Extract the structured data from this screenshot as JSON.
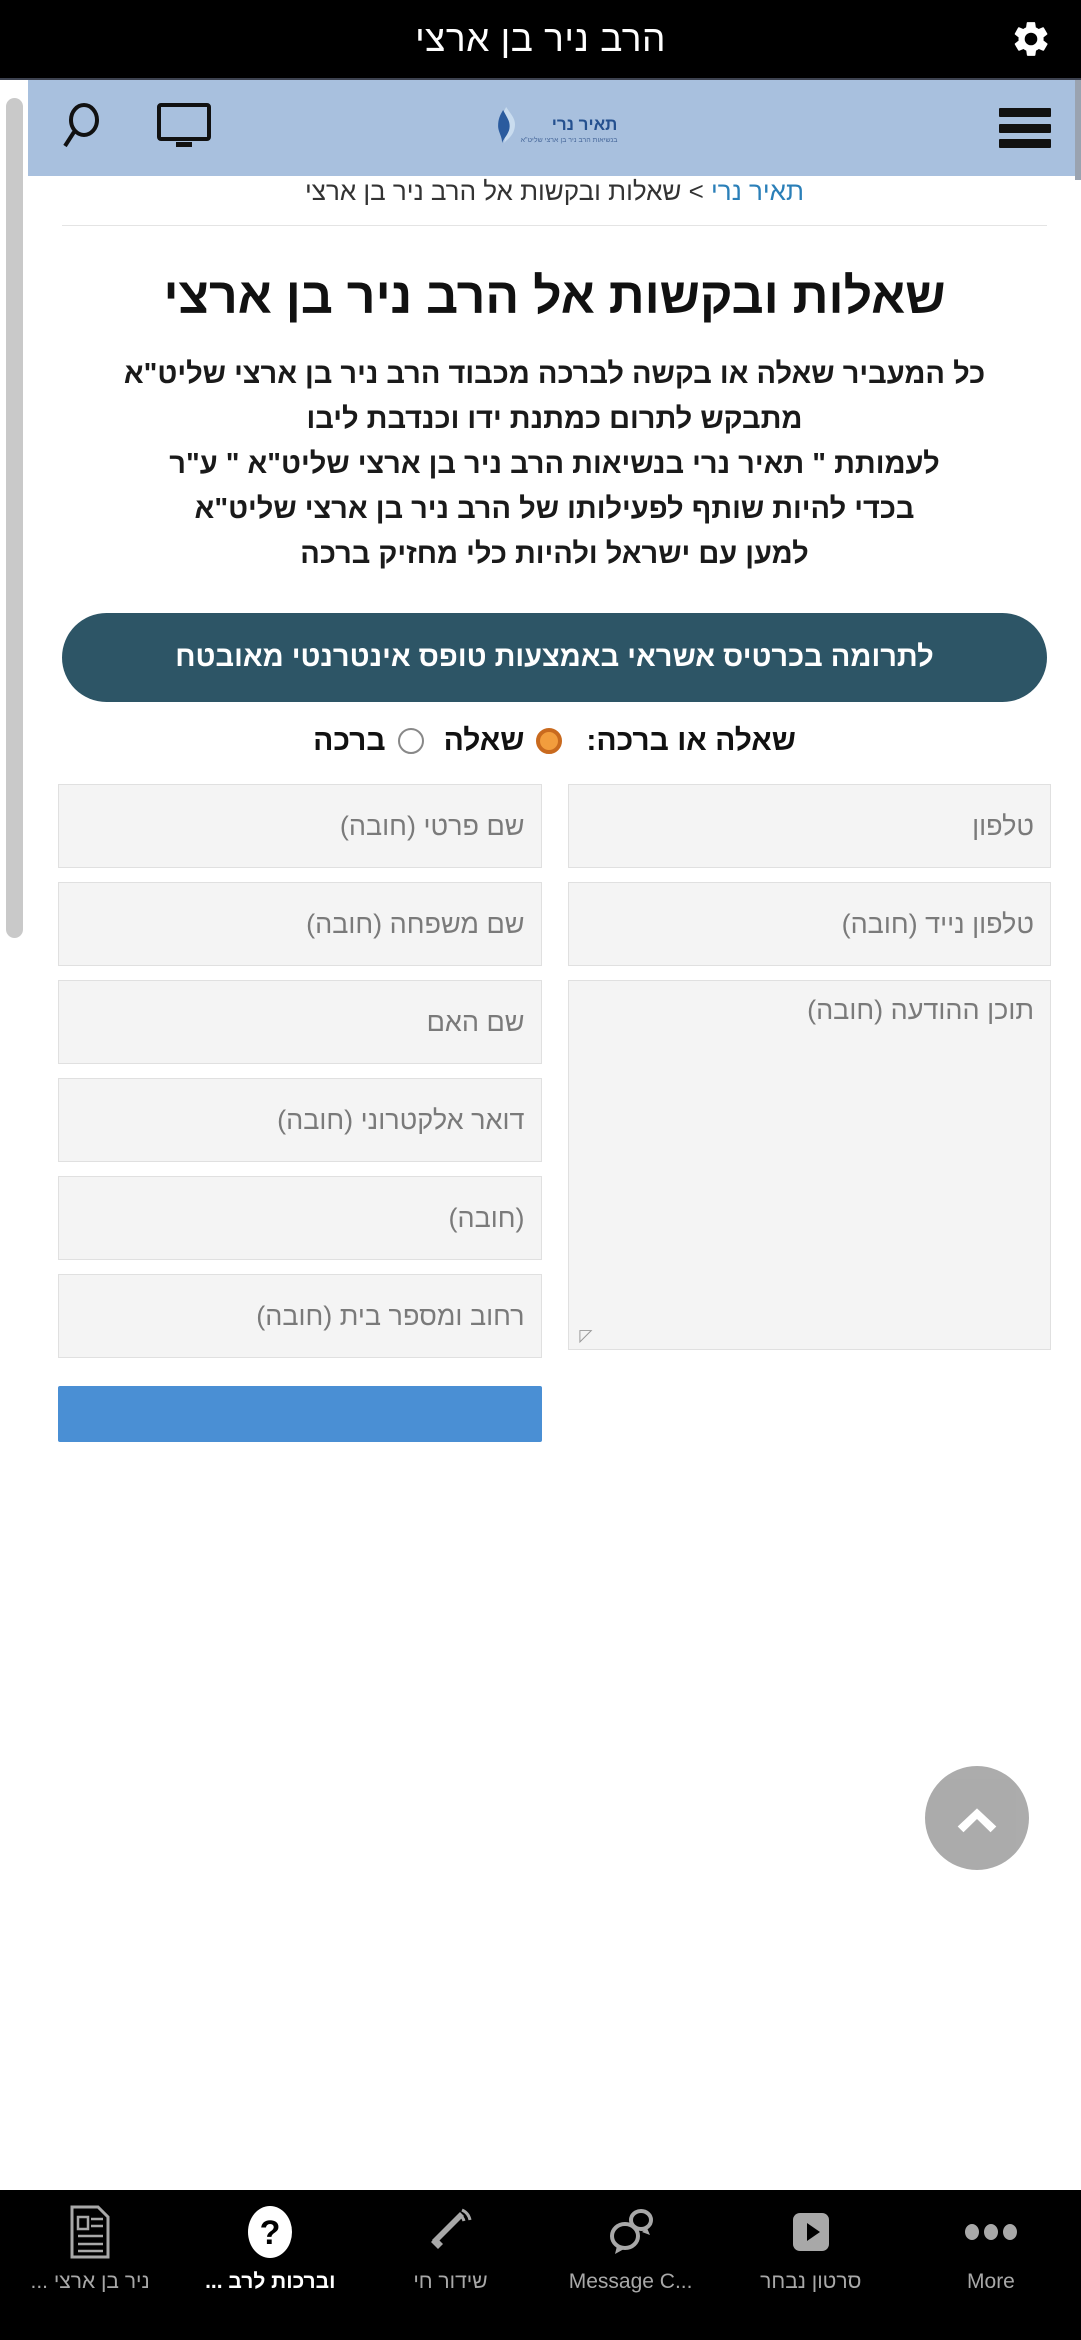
{
  "appbar": {
    "title": "הרב ניר בן ארצי",
    "gear_icon": "gear-icon"
  },
  "site_header": {
    "logo_text": "תאיר נרי",
    "logo_sub": "בנשיאות הרב ניר בן ארצי שליט\"א",
    "search_icon": "search-icon",
    "monitor_icon": "monitor-icon",
    "menu_icon": "hamburger-menu-icon"
  },
  "breadcrumb": {
    "root": "תאיר נרי",
    "separator": " > ",
    "current": "שאלות ובקשות אל הרב ניר בן ארצי"
  },
  "page": {
    "title": "שאלות ובקשות אל הרב ניר בן ארצי",
    "intro_lines": [
      "כל המעביר שאלה או בקשה לברכה מכבוד הרב ניר בן ארצי שליט\"א",
      "מתבקש לתרום כמתנת ידו וכנדבת ליבו",
      "לעמותת \" תאיר נרי בנשיאות הרב ניר בן ארצי שליט\"א \" ע\"ר",
      "בכדי להיות שותף לפעילותו של הרב ניר בן ארצי שליט\"א",
      "למען עם ישראל ולהיות כלי מחזיק ברכה"
    ]
  },
  "donate_button": {
    "label": "לתרומה בכרטיס אשראי באמצעות טופס אינטרנטי מאובטח"
  },
  "radio_group": {
    "label": "שאלה או ברכה:",
    "options": [
      {
        "label": "שאלה",
        "checked": true
      },
      {
        "label": "ברכה",
        "checked": false
      }
    ]
  },
  "form": {
    "right_column": [
      {
        "placeholder": "טלפון"
      },
      {
        "placeholder": "טלפון נייד (חובה)"
      }
    ],
    "left_column": [
      {
        "placeholder": "שם פרטי (חובה)"
      },
      {
        "placeholder": "שם משפחה (חובה)"
      },
      {
        "placeholder": "שם האם"
      },
      {
        "placeholder": "דואר אלקטרוני (חובה)"
      },
      {
        "placeholder": "(חובה)"
      },
      {
        "placeholder": "רחוב ומספר בית (חובה)"
      }
    ],
    "message": {
      "placeholder": "תוכן ההודעה (חובה)"
    },
    "submit_label": ""
  },
  "fab": {
    "icon": "chevron-up-icon"
  },
  "bottom_nav": {
    "items": [
      {
        "label": "ניר בן ארצי ...",
        "icon": "document-form-icon",
        "active": false,
        "rtl": true
      },
      {
        "label": "וברכות לרב ...",
        "icon": "question-mark-icon",
        "active": true,
        "rtl": true
      },
      {
        "label": "שידור חי",
        "icon": "megaphone-icon",
        "active": false,
        "rtl": true
      },
      {
        "label": "Message C...",
        "icon": "chat-bubbles-icon",
        "active": false,
        "rtl": false
      },
      {
        "label": "סרטון נבחר",
        "icon": "video-play-icon",
        "active": false,
        "rtl": true
      },
      {
        "label": "More",
        "icon": "more-dots-icon",
        "active": false,
        "rtl": false
      }
    ]
  },
  "colors": {
    "appbar_bg": "#000000",
    "site_header_bg": "#a8c0de",
    "brand_blue": "#24508f",
    "link_blue": "#2a7fb8",
    "donate_bg": "#2d5566",
    "radio_accent": "#f29d3d",
    "submit_blue": "#4a8fd4"
  }
}
